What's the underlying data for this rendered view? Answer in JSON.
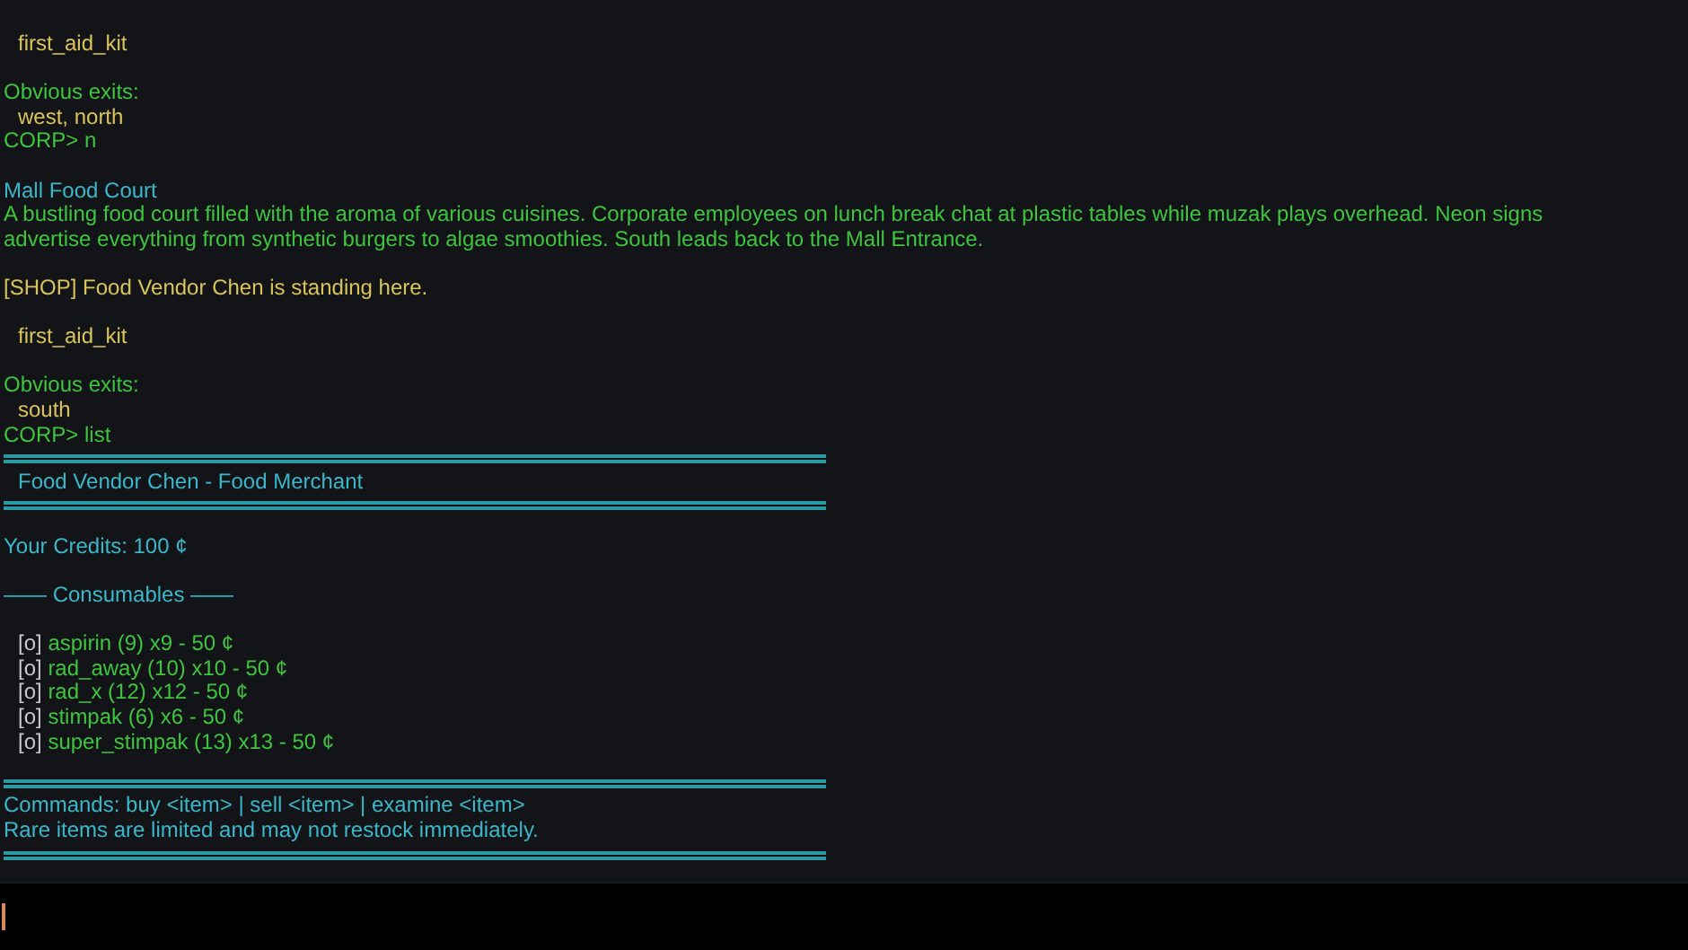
{
  "log": [
    {
      "lines": [
        {
          "kind": "item",
          "text": "first_aid_kit"
        }
      ]
    },
    {
      "lines": [
        {
          "kind": "label",
          "text": "Obvious exits:"
        },
        {
          "kind": "exits",
          "text": "west, north"
        },
        {
          "kind": "prompt",
          "text": "CORP> n"
        }
      ]
    },
    {
      "lines": [
        {
          "kind": "room",
          "text": "Mall Food Court"
        },
        {
          "kind": "desc",
          "text": "A bustling food court filled with the aroma of various cuisines. Corporate employees on lunch break chat at plastic tables while muzak plays overhead. Neon signs advertise everything from synthetic burgers to algae smoothies. South leads back to the Mall Entrance."
        }
      ]
    },
    {
      "lines": [
        {
          "kind": "npc",
          "text": "[SHOP] Food Vendor Chen is standing here."
        }
      ]
    },
    {
      "lines": [
        {
          "kind": "item",
          "text": "first_aid_kit"
        }
      ]
    },
    {
      "lines": [
        {
          "kind": "label",
          "text": "Obvious exits:"
        },
        {
          "kind": "exits",
          "text": "south"
        },
        {
          "kind": "prompt",
          "text": "CORP> list"
        },
        {
          "kind": "rule"
        },
        {
          "kind": "header",
          "text": "Food Vendor Chen - Food Merchant"
        },
        {
          "kind": "rule"
        }
      ]
    },
    {
      "lines": [
        {
          "kind": "info",
          "text": "Your Credits: 100 ¢"
        }
      ]
    },
    {
      "lines": [
        {
          "kind": "category",
          "text": "—— Consumables ——"
        }
      ]
    },
    {
      "lines": [
        {
          "kind": "ware",
          "marker": "[o]",
          "text": "aspirin (9) x9 - 50 ¢"
        },
        {
          "kind": "ware",
          "marker": "[o]",
          "text": "rad_away (10) x10 - 50 ¢"
        },
        {
          "kind": "ware",
          "marker": "[o]",
          "text": "rad_x (12) x12 - 50 ¢"
        },
        {
          "kind": "ware",
          "marker": "[o]",
          "text": "stimpak (6) x6 - 50 ¢"
        },
        {
          "kind": "ware",
          "marker": "[o]",
          "text": "super_stimpak (13) x13 - 50 ¢"
        }
      ]
    },
    {
      "lines": [
        {
          "kind": "rule"
        },
        {
          "kind": "info",
          "text": "Commands: buy <item> | sell <item> | examine <item>"
        },
        {
          "kind": "info",
          "text": "Rare items are limited and may not restock immediately."
        },
        {
          "kind": "rule"
        }
      ]
    }
  ],
  "input": {
    "focused": true
  }
}
